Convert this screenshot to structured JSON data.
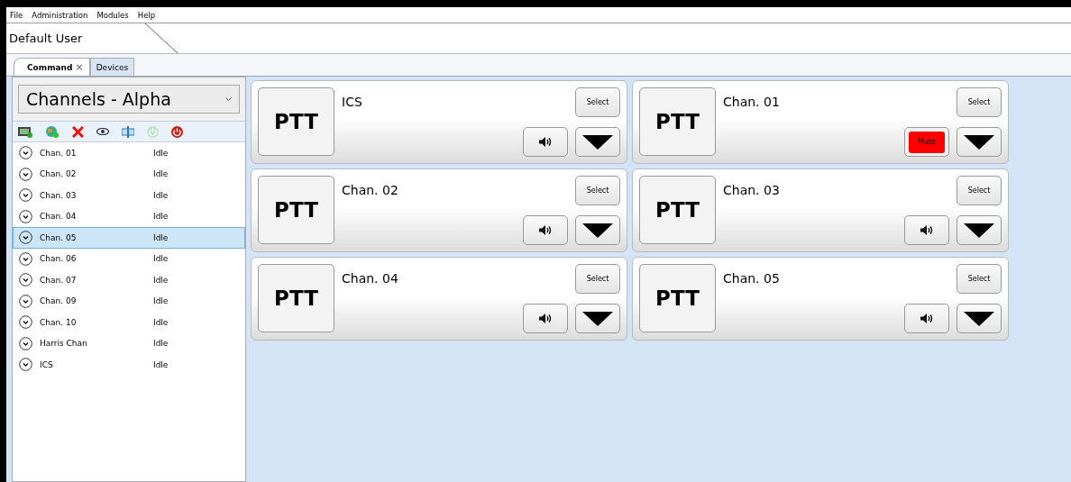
{
  "menu": [
    "File",
    "Administration",
    "Modules",
    "Help"
  ],
  "user": "Default User",
  "tabs": [
    {
      "label": "Command",
      "selected": true,
      "closable": true
    },
    {
      "label": "Devices",
      "selected": false,
      "closable": false
    }
  ],
  "close_glyph": "×",
  "channel_group": "Channels - Alpha",
  "channel_list": [
    {
      "name": "Chan. 01",
      "status": "Idle",
      "selected": false
    },
    {
      "name": "Chan. 02",
      "status": "Idle",
      "selected": false
    },
    {
      "name": "Chan. 03",
      "status": "Idle",
      "selected": false
    },
    {
      "name": "Chan. 04",
      "status": "Idle",
      "selected": false
    },
    {
      "name": "Chan. 05",
      "status": "Idle",
      "selected": true
    },
    {
      "name": "Chan. 06",
      "status": "Idle",
      "selected": false
    },
    {
      "name": "Chan. 07",
      "status": "Idle",
      "selected": false
    },
    {
      "name": "Chan. 09",
      "status": "Idle",
      "selected": false
    },
    {
      "name": "Chan. 10",
      "status": "Idle",
      "selected": false
    },
    {
      "name": "Harris Chan",
      "status": "Idle",
      "selected": false
    },
    {
      "name": "ICS",
      "status": "Idle",
      "selected": false
    }
  ],
  "cards": [
    {
      "name": "ICS",
      "ptt": "PTT",
      "select": "Select",
      "muted": false
    },
    {
      "name": "Chan. 01",
      "ptt": "PTT",
      "select": "Select",
      "muted": true,
      "mute_label": "Mute"
    },
    {
      "name": "Chan. 02",
      "ptt": "PTT",
      "select": "Select",
      "muted": false
    },
    {
      "name": "Chan. 03",
      "ptt": "PTT",
      "select": "Select",
      "muted": false
    },
    {
      "name": "Chan. 04",
      "ptt": "PTT",
      "select": "Select",
      "muted": false
    },
    {
      "name": "Chan. 05",
      "ptt": "PTT",
      "select": "Select",
      "muted": false
    }
  ]
}
